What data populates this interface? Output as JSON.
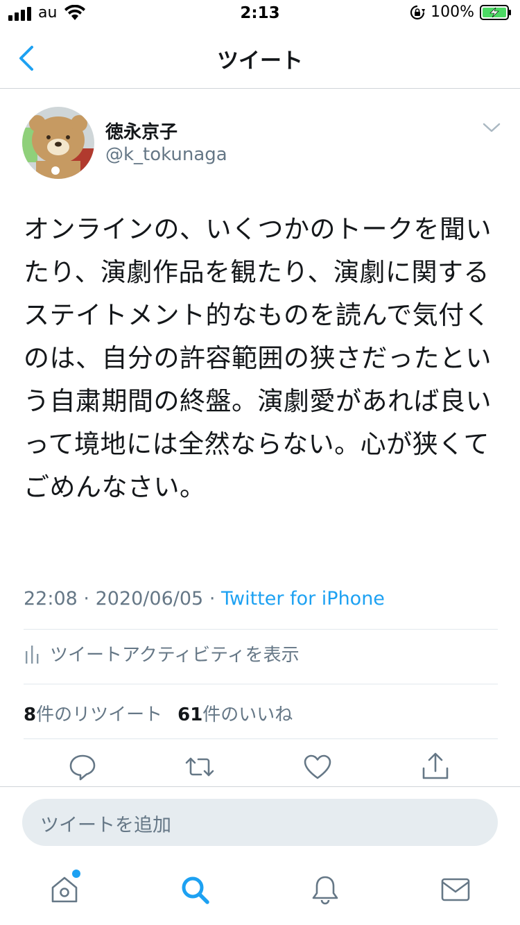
{
  "status_bar": {
    "carrier": "au",
    "time": "2:13",
    "battery_percent": "100%",
    "signal_bars": 4,
    "icons": [
      "signal-icon",
      "wifi-icon",
      "rotation-lock-icon",
      "battery-charging-icon"
    ]
  },
  "nav": {
    "title": "ツイート",
    "back_icon": "chevron-left-icon"
  },
  "tweet": {
    "author_name": "徳永京子",
    "author_handle": "@k_tokunaga",
    "text": "オンラインの、いくつかのトークを聞いたり、演劇作品を観たり、演劇に関するステイトメント的なものを読んで気付くのは、自分の許容範囲の狭さだったという自粛期間の終盤。演劇愛があれば良いって境地には全然ならない。心が狭くてごめんなさい。",
    "time": "22:08",
    "date": "2020/06/05",
    "separator": "·",
    "source": "Twitter for iPhone",
    "activity_label": "ツイートアクティビティを表示",
    "retweet_count": "8",
    "retweet_label": "件のリツイート",
    "like_count": "61",
    "like_label": "件のいいね"
  },
  "actions": [
    "reply-icon",
    "retweet-icon",
    "like-icon",
    "share-icon"
  ],
  "compose": {
    "placeholder": "ツイートを追加"
  },
  "tabbar": {
    "items": [
      "home-icon",
      "search-icon",
      "notifications-icon",
      "messages-icon"
    ],
    "active": "search-icon",
    "home_has_notification": true
  },
  "colors": {
    "accent": "#1da1f2",
    "text_primary": "#14171a",
    "text_secondary": "#657786",
    "divider": "#e1e8ed",
    "compose_bg": "#e6ecf0",
    "battery_green": "#4cd964"
  }
}
